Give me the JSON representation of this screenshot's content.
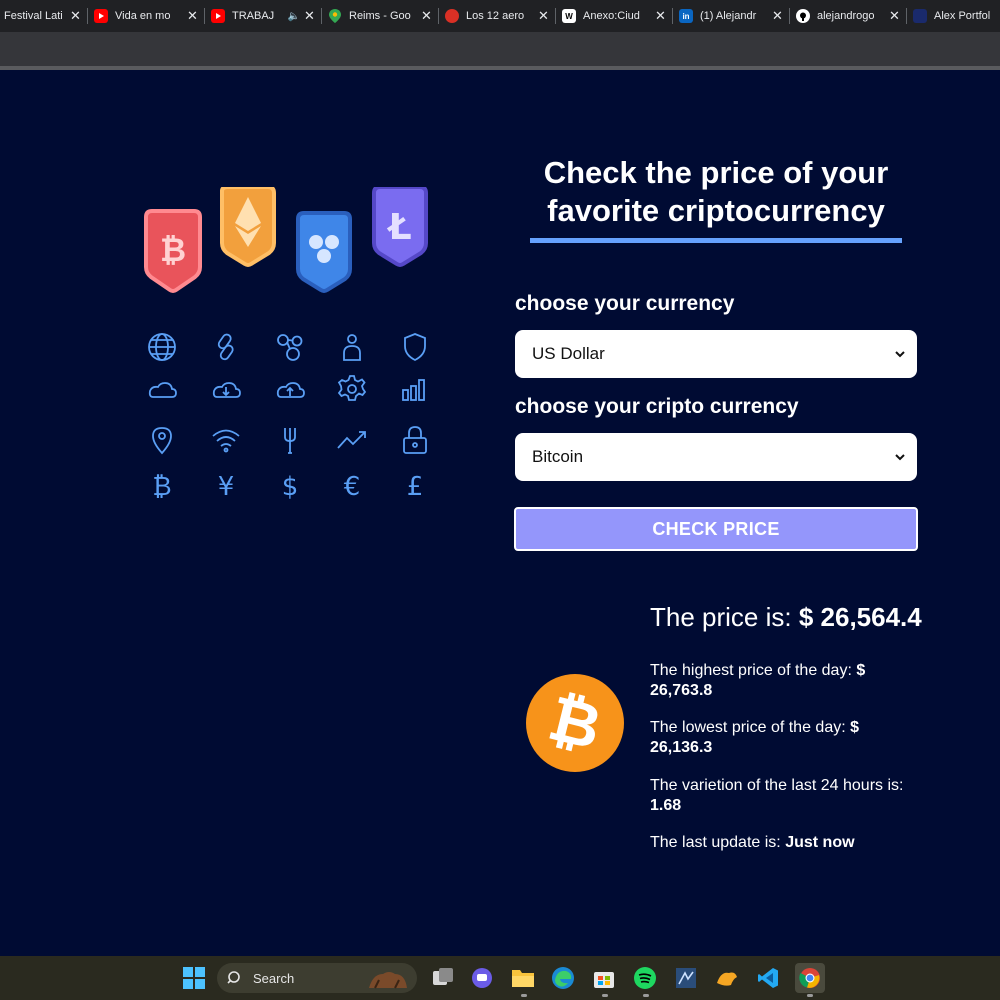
{
  "browser": {
    "tabs": [
      {
        "title": "Festival Lati",
        "favicon": "generic-icon",
        "color": "#1f3a5f"
      },
      {
        "title": "Vida en mo",
        "favicon": "youtube-icon",
        "color": "#ff0000"
      },
      {
        "title": "TRABAJ",
        "favicon": "youtube-icon",
        "color": "#ff0000",
        "audio": "🔈"
      },
      {
        "title": "Reims - Goo",
        "favicon": "maps-icon",
        "color": "#34a853"
      },
      {
        "title": "Los 12 aero",
        "favicon": "generic-icon",
        "color": "#d93025"
      },
      {
        "title": "Anexo:Ciud",
        "favicon": "wikipedia-icon",
        "color": "#ffffff",
        "glyph": "W"
      },
      {
        "title": "(1) Alejandr",
        "favicon": "linkedin-icon",
        "color": "#0a66c2",
        "glyph": "in"
      },
      {
        "title": "alejandrogo",
        "favicon": "github-icon",
        "color": "#ffffff"
      },
      {
        "title": "Alex Portfol",
        "favicon": "portfolio-icon",
        "color": "#1a2a6c"
      }
    ],
    "close_glyph": "✕"
  },
  "hero": {
    "badges": [
      {
        "name": "bitcoin",
        "glyph": "₿",
        "fill": "#e9545b",
        "border": "#ff7e86"
      },
      {
        "name": "ethereum",
        "glyph": "◆",
        "fill": "#f2a03d",
        "border": "#ffb85c"
      },
      {
        "name": "ripple",
        "glyph": "✻",
        "fill": "#3f86e8",
        "border": "#2a63c2"
      },
      {
        "name": "litecoin",
        "glyph": "Ł",
        "fill": "#7a6cf0",
        "border": "#5b4ec9"
      }
    ],
    "icon_color": "#5a9ff5",
    "icons": [
      [
        "globe-icon",
        "link-icon",
        "molecule-icon",
        "person-icon",
        "shield-icon"
      ],
      [
        "cloud-icon",
        "cloud-download-icon",
        "cloud-upload-icon",
        "gear-icon",
        "bar-chart-icon"
      ],
      [
        "map-pin-icon",
        "wifi-icon",
        "fork-icon",
        "trend-up-icon",
        "lock-icon"
      ],
      [
        "bitcoin-symbol-icon",
        "yen-icon",
        "dollar-icon",
        "euro-icon",
        "pound-icon"
      ]
    ],
    "currency_glyphs": [
      "₿",
      "¥",
      "$",
      "€",
      "£"
    ]
  },
  "form": {
    "heading_line1": "Check the price of your",
    "heading_line2": "favorite criptocurrency",
    "currency_label": "choose your currency",
    "currency_value": "US Dollar",
    "crypto_label": "choose your cripto currency",
    "crypto_value": "Bitcoin",
    "submit_label": "CHECK PRICE"
  },
  "result": {
    "price_label": "The price is:",
    "price_value": "$ 26,564.4",
    "high_label": "The highest price of the day:",
    "high_value": "$ 26,763.8",
    "low_label": "The lowest price of the day:",
    "low_value": "$ 26,136.3",
    "change_label": "The varietion of the last 24 hours is:",
    "change_value": "1.68",
    "update_label": "The last update is:",
    "update_value": "Just now",
    "coin_glyph": "₿"
  },
  "taskbar": {
    "search_placeholder": "Search",
    "apps": [
      "start-icon",
      "task-view-icon",
      "teams-icon",
      "file-explorer-icon",
      "edge-icon",
      "store-icon",
      "spotify-icon",
      "sql-icon",
      "app-icon",
      "vscode-icon",
      "chrome-icon"
    ]
  },
  "colors": {
    "page_bg": "#000b33",
    "accent_bar": "#66a2fe",
    "button": "#9496fb",
    "bitcoin": "#f7931a"
  }
}
